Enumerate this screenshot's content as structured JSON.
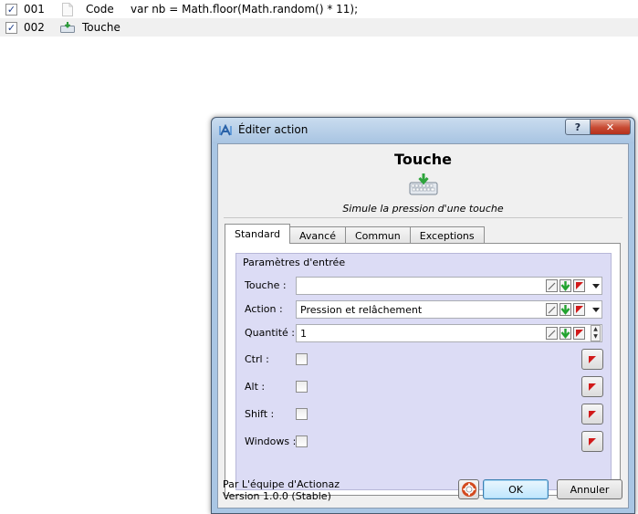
{
  "list": {
    "rows": [
      {
        "num": "001",
        "kind": "Code",
        "code": "var nb = Math.floor(Math.random() * 11);",
        "icon": "document-icon",
        "checked": true
      },
      {
        "num": "002",
        "kind": "Touche",
        "code": "",
        "icon": "keyboard-icon",
        "checked": true
      }
    ]
  },
  "dialog": {
    "title": "Éditer action",
    "action_name": "Touche",
    "action_description": "Simule la pression d'une touche",
    "tabs": [
      "Standard",
      "Avancé",
      "Commun",
      "Exceptions"
    ],
    "active_tab": "Standard",
    "group_title": "Paramètres d'entrée",
    "fields": {
      "touche": {
        "label": "Touche :",
        "value": ""
      },
      "action": {
        "label": "Action :",
        "value": "Pression et relâchement"
      },
      "quantite": {
        "label": "Quantité :",
        "value": "1"
      },
      "ctrl": {
        "label": "Ctrl :",
        "checked": false
      },
      "alt": {
        "label": "Alt :",
        "checked": false
      },
      "shift": {
        "label": "Shift :",
        "checked": false
      },
      "windows": {
        "label": "Windows :",
        "checked": false
      }
    },
    "credit_line1": "Par L'équipe d'Actionaz",
    "credit_line2": "Version 1.0.0 (Stable)",
    "ok_label": "OK",
    "cancel_label": "Annuler",
    "help_label": "?",
    "close_label": "✕"
  },
  "colors": {
    "title_bar": "#a8c4e2",
    "group_background": "#dcdcf5",
    "close_button": "#c74a32"
  }
}
